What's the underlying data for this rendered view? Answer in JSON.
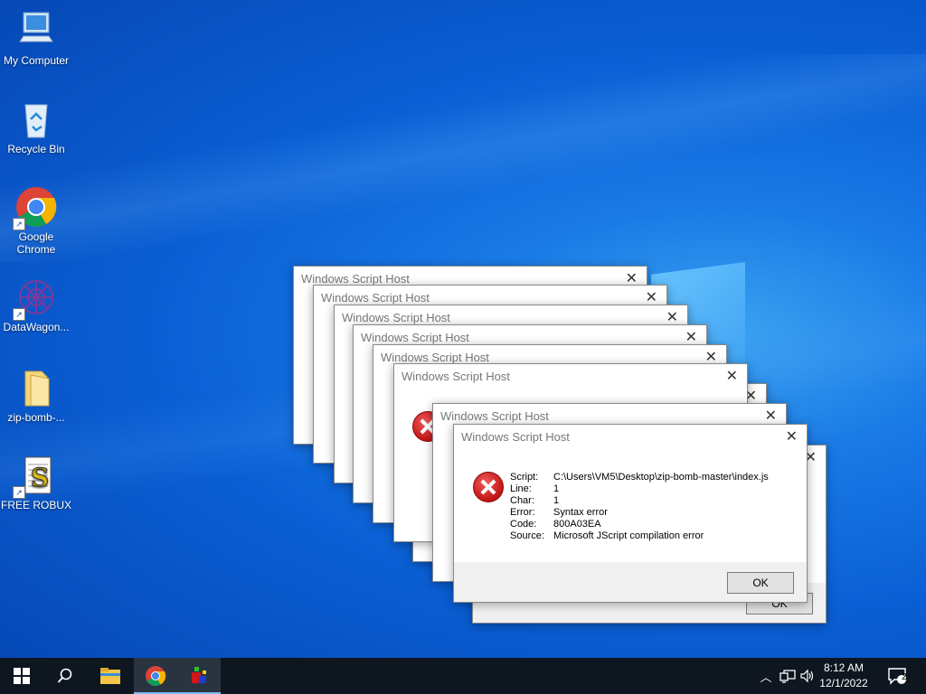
{
  "desktop": {
    "icons": [
      {
        "label": "My Computer"
      },
      {
        "label": "Recycle Bin"
      },
      {
        "label": "Google Chrome"
      },
      {
        "label": "DataWagon..."
      },
      {
        "label": "zip-bomb-..."
      },
      {
        "label": "FREE ROBUX"
      }
    ]
  },
  "dialog": {
    "title": "Windows Script Host",
    "close_glyph": "✕",
    "ok_label": "OK",
    "details": [
      {
        "key": "Script:",
        "value": "C:\\Users\\VM5\\Desktop\\zip-bomb-master\\index.js"
      },
      {
        "key": "Line:",
        "value": "1"
      },
      {
        "key": "Char:",
        "value": "1"
      },
      {
        "key": "Error:",
        "value": "Syntax error"
      },
      {
        "key": "Code:",
        "value": "800A03EA"
      },
      {
        "key": "Source:",
        "value": "Microsoft JScript compilation error"
      }
    ]
  },
  "taskbar": {
    "start_icon": "windows-icon",
    "search_icon": "search-icon",
    "pinned": [
      "file-explorer-icon",
      "chrome-icon",
      "app-icon"
    ],
    "time": "8:12 AM",
    "date": "12/1/2022",
    "notification_count": "2"
  },
  "colors": {
    "error_red": "#c21414",
    "taskbar_bg": "#0e1620"
  }
}
